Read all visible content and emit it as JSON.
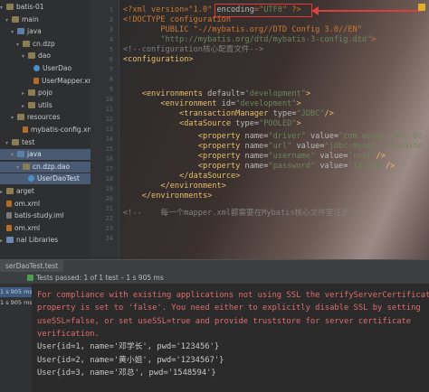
{
  "project_tree": {
    "items": [
      {
        "label": "batis-01",
        "indent": 0,
        "icon": "folder-icon",
        "chev": "▾"
      },
      {
        "label": "main",
        "indent": 1,
        "icon": "folder-icon",
        "chev": "▾"
      },
      {
        "label": "java",
        "indent": 2,
        "icon": "folder-blue-icon",
        "chev": "▾"
      },
      {
        "label": "cn.dzp",
        "indent": 3,
        "icon": "package-icon",
        "chev": "▾"
      },
      {
        "label": "dao",
        "indent": 4,
        "icon": "package-icon",
        "chev": "▾"
      },
      {
        "label": "UserDao",
        "indent": 5,
        "icon": "interface-icon",
        "chev": ""
      },
      {
        "label": "UserMapper.xml",
        "indent": 5,
        "icon": "xml-file-icon",
        "chev": ""
      },
      {
        "label": "pojo",
        "indent": 4,
        "icon": "package-icon",
        "chev": "▸"
      },
      {
        "label": "utils",
        "indent": 4,
        "icon": "package-icon",
        "chev": "▸"
      },
      {
        "label": "resources",
        "indent": 2,
        "icon": "folder-icon",
        "chev": "▾"
      },
      {
        "label": "mybatis-config.xml",
        "indent": 3,
        "icon": "xml-file-icon",
        "chev": ""
      },
      {
        "label": "test",
        "indent": 1,
        "icon": "folder-icon",
        "chev": "▾"
      },
      {
        "label": "java",
        "indent": 2,
        "icon": "folder-blue-icon",
        "chev": "▾"
      },
      {
        "label": "cn.dzp.dao",
        "indent": 3,
        "icon": "package-icon",
        "chev": "▾"
      },
      {
        "label": "UserDaoTest",
        "indent": 4,
        "icon": "java-class-icon",
        "chev": ""
      },
      {
        "label": "arget",
        "indent": 0,
        "icon": "folder-icon",
        "chev": "▸"
      },
      {
        "label": "om.xml",
        "indent": 0,
        "icon": "xml-file-icon",
        "chev": ""
      },
      {
        "label": "batis-study.iml",
        "indent": 0,
        "icon": "iml-file-icon",
        "chev": ""
      },
      {
        "label": "om.xml",
        "indent": 0,
        "icon": "xml-file-icon",
        "chev": ""
      },
      {
        "label": "nal Libraries",
        "indent": 0,
        "icon": "libraries-icon",
        "chev": "▸"
      }
    ]
  },
  "editor": {
    "line_numbers": [
      "1",
      "2",
      "3",
      "4",
      "5",
      "6",
      "7",
      "8",
      "9",
      "10",
      "11",
      "12",
      "13",
      "14",
      "15",
      "16",
      "17",
      "18",
      "19",
      "20",
      "21",
      "22",
      "23",
      "24"
    ],
    "lines": [
      [
        [
          "dt",
          "<?xml version=\"1.0\" "
        ],
        [
          "attr",
          "encoding"
        ],
        [
          "dt",
          "=\""
        ],
        [
          "val",
          "UTF8"
        ],
        [
          "dt",
          "\" ?>"
        ]
      ],
      [
        [
          "dt",
          "<!DOCTYPE configuration"
        ]
      ],
      [
        [
          "dt",
          "        PUBLIC \"-//mybatis.org//DTD Config 3.0//EN\""
        ]
      ],
      [
        [
          "val",
          "        \"http://mybatis.org/dtd/mybatis-3-config.dtd\""
        ],
        [
          "dt",
          ">"
        ]
      ],
      [
        [
          "cmt",
          "<!--configuration核心配置文件-->"
        ]
      ],
      [
        [
          "tag",
          "<configuration>"
        ]
      ],
      [
        [
          "out",
          ""
        ]
      ],
      [
        [
          "tag",
          "    <environments "
        ],
        [
          "attr",
          "default"
        ],
        [
          "out",
          "="
        ],
        [
          "val",
          "\"development\""
        ],
        [
          "tag",
          ">"
        ]
      ],
      [
        [
          "tag",
          "        <environment "
        ],
        [
          "attr",
          "id"
        ],
        [
          "out",
          "="
        ],
        [
          "val",
          "\"development\""
        ],
        [
          "tag",
          ">"
        ]
      ],
      [
        [
          "tag",
          "            <transactionManager "
        ],
        [
          "attr",
          "type"
        ],
        [
          "out",
          "="
        ],
        [
          "val",
          "\"JDBC\""
        ],
        [
          "tag",
          "/>"
        ]
      ],
      [
        [
          "tag",
          "            <dataSource "
        ],
        [
          "attr",
          "type"
        ],
        [
          "out",
          "="
        ],
        [
          "val",
          "\"POOLED\""
        ],
        [
          "tag",
          ">"
        ]
      ],
      [
        [
          "tag",
          "                <property "
        ],
        [
          "attr",
          "name"
        ],
        [
          "out",
          "="
        ],
        [
          "val",
          "\"driver\" "
        ],
        [
          "attr",
          "value"
        ],
        [
          "out",
          "="
        ],
        [
          "val",
          "\"com.mysql.jdbc.Dr"
        ]
      ],
      [
        [
          "tag",
          "                <property "
        ],
        [
          "attr",
          "name"
        ],
        [
          "out",
          "="
        ],
        [
          "val",
          "\"url\" "
        ],
        [
          "attr",
          "value"
        ],
        [
          "out",
          "="
        ],
        [
          "val",
          "\"jdbc:mysql://localho"
        ]
      ],
      [
        [
          "tag",
          "                <property "
        ],
        [
          "attr",
          "name"
        ],
        [
          "out",
          "="
        ],
        [
          "val",
          "\"username\" "
        ],
        [
          "attr",
          "value"
        ],
        [
          "out",
          "="
        ],
        [
          "val",
          "\"root\""
        ],
        [
          "tag",
          "/>"
        ]
      ],
      [
        [
          "tag",
          "                <property "
        ],
        [
          "attr",
          "name"
        ],
        [
          "out",
          "="
        ],
        [
          "val",
          "\"password\" "
        ],
        [
          "attr",
          "value"
        ],
        [
          "out",
          "="
        ],
        [
          "val",
          "\"123456\""
        ],
        [
          "tag",
          "/>"
        ]
      ],
      [
        [
          "tag",
          "            </dataSource>"
        ]
      ],
      [
        [
          "tag",
          "        </environment>"
        ]
      ],
      [
        [
          "tag",
          "    </environments>"
        ]
      ],
      [
        [
          "cmt",
          "<!--    每一个mapper.xml都需要在Mybatis核心文件里注册-->"
        ]
      ]
    ]
  },
  "run_panel": {
    "tab_label": "serDaoTest.test",
    "status": "Tests passed: 1 of 1 test – 1 s 905 ms",
    "left_items": [
      {
        "label": "1 s 905 ms",
        "selected": true
      },
      {
        "label": "1 s 905 ms",
        "selected": false
      }
    ],
    "console_lines": [
      {
        "cls": "err",
        "text": "For compliance with existing applications not using SSL the verifyServerCertificat"
      },
      {
        "cls": "err",
        "text": "property is set to 'false'. You need either to explicitly disable SSL by setting"
      },
      {
        "cls": "err",
        "text": "useSSL=false, or set useSSL=true and provide truststore for server certificate"
      },
      {
        "cls": "err",
        "text": "verification."
      },
      {
        "cls": "out",
        "text": "User{id=1, name='邓学长', pwd='123456'}"
      },
      {
        "cls": "out",
        "text": "User{id=2, name='黄小姐', pwd='1234567'}"
      },
      {
        "cls": "out",
        "text": "User{id=3, name='邓总', pwd='1548594'}"
      }
    ]
  },
  "colors": {
    "accent_red": "#e23a3a",
    "selection_blue": "#4a5a73",
    "xml_tag": "#e8bf6a",
    "xml_value": "#6a8759",
    "comment": "#808080",
    "error_text": "#e06c6c"
  }
}
